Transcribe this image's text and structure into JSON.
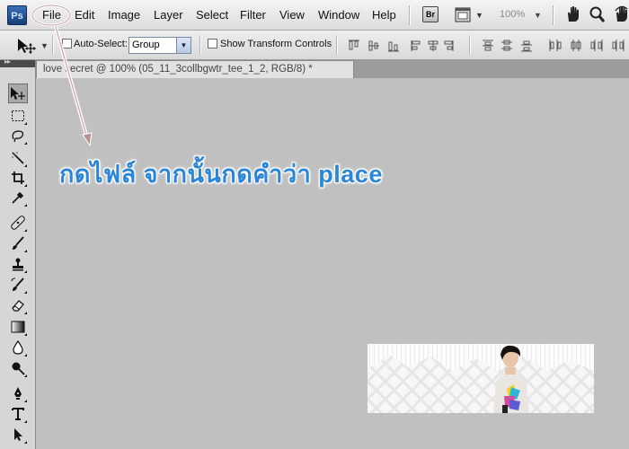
{
  "app": {
    "logo": "Ps"
  },
  "menubar": {
    "items": [
      {
        "label": "File"
      },
      {
        "label": "Edit"
      },
      {
        "label": "Image"
      },
      {
        "label": "Layer"
      },
      {
        "label": "Select"
      },
      {
        "label": "Filter"
      },
      {
        "label": "View"
      },
      {
        "label": "Window"
      },
      {
        "label": "Help"
      }
    ],
    "bridge_label": "Br",
    "zoom": "100%",
    "icons": [
      "bridge-icon",
      "screen-mode-icon",
      "hand-icon",
      "zoom-icon",
      "rotate-icon"
    ]
  },
  "options": {
    "auto_select_label": "Auto-Select:",
    "auto_select_checked": false,
    "auto_select_value": "Group",
    "show_transform_label": "Show Transform Controls",
    "show_transform_checked": false
  },
  "toolbox": {
    "tools": [
      "move-tool",
      "marquee-tool",
      "lasso-tool",
      "magic-wand-tool",
      "crop-tool",
      "eyedropper-tool",
      "healing-brush-tool",
      "brush-tool",
      "clone-stamp-tool",
      "history-brush-tool",
      "eraser-tool",
      "gradient-tool",
      "blur-tool",
      "dodge-tool",
      "pen-tool",
      "type-tool",
      "path-selection-tool"
    ],
    "active": "move-tool"
  },
  "document": {
    "tab_title": "love secret @ 100% (05_11_3collbgwtr_tee_1_2, RGB/8) *"
  },
  "annotation": {
    "text": "กดไฟล์ จากนั้นกดคำว่า place",
    "color": "#2c86d8",
    "highlight_color": "#ffffff"
  }
}
